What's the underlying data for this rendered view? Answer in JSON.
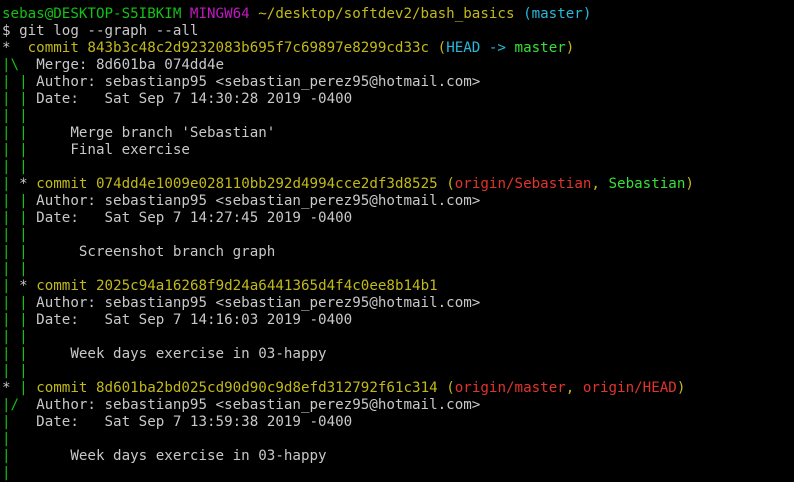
{
  "prompt": {
    "user_host": "sebas@DESKTOP-S5IBKIM",
    "shell": "MINGW64",
    "path": "~/desktop/softdev2/bash_basics",
    "branch": "(master)",
    "symbol": "$",
    "command": "git log --graph --all"
  },
  "commits": [
    {
      "graph_head": "*  ",
      "label": "commit",
      "hash": "843b3c48c2d9232083b695f7c69897e8299cd33c",
      "refs_open": "(",
      "head_ref": "HEAD -> ",
      "local_branch": "master",
      "refs_close": ")",
      "merge": "Merge: 8d601ba 074dd4e",
      "author": "Author: sebastianp95 <sebastian_perez95@hotmail.com>",
      "date": "Date:   Sat Sep 7 14:30:28 2019 -0400",
      "message_lines": [
        "Merge branch 'Sebastian'",
        "Final exercise"
      ]
    },
    {
      "graph_head": "* ",
      "label": "commit",
      "hash": "074dd4e1009e028110bb292d4994cce2df3d8525",
      "refs_open": "(",
      "remote_branch": "origin/Sebastian",
      "sep": ", ",
      "local_branch": "Sebastian",
      "refs_close": ")",
      "author": "Author: sebastianp95 <sebastian_perez95@hotmail.com>",
      "date": "Date:   Sat Sep 7 14:27:45 2019 -0400",
      "message_lines": [
        "Screenshot branch graph"
      ]
    },
    {
      "graph_head": "* ",
      "label": "commit",
      "hash": "2025c94a16268f9d24a6441365d4f4c0ee8b14b1",
      "author": "Author: sebastianp95 <sebastian_perez95@hotmail.com>",
      "date": "Date:   Sat Sep 7 14:16:03 2019 -0400",
      "message_lines": [
        "Week days exercise in 03-happy"
      ]
    },
    {
      "graph_head": "* ",
      "label": "commit",
      "hash": "8d601ba2bd025cd90d90c9d8efd312792f61c314",
      "refs_open": "(",
      "remote_branch": "origin/master",
      "sep": ", ",
      "remote_head": "origin/HEAD",
      "refs_close": ")",
      "author": "Author: sebastianp95 <sebastian_perez95@hotmail.com>",
      "date": "Date:   Sat Sep 7 13:59:38 2019 -0400",
      "message_lines": [
        "Week days exercise in 03-happy"
      ]
    }
  ],
  "colors": {
    "background": "#000000",
    "text": "#c0c0c0",
    "green": "#13c213",
    "magenta": "#c217c2",
    "yellow": "#c2b918",
    "cyan": "#29b8db",
    "red": "#e0342c"
  }
}
